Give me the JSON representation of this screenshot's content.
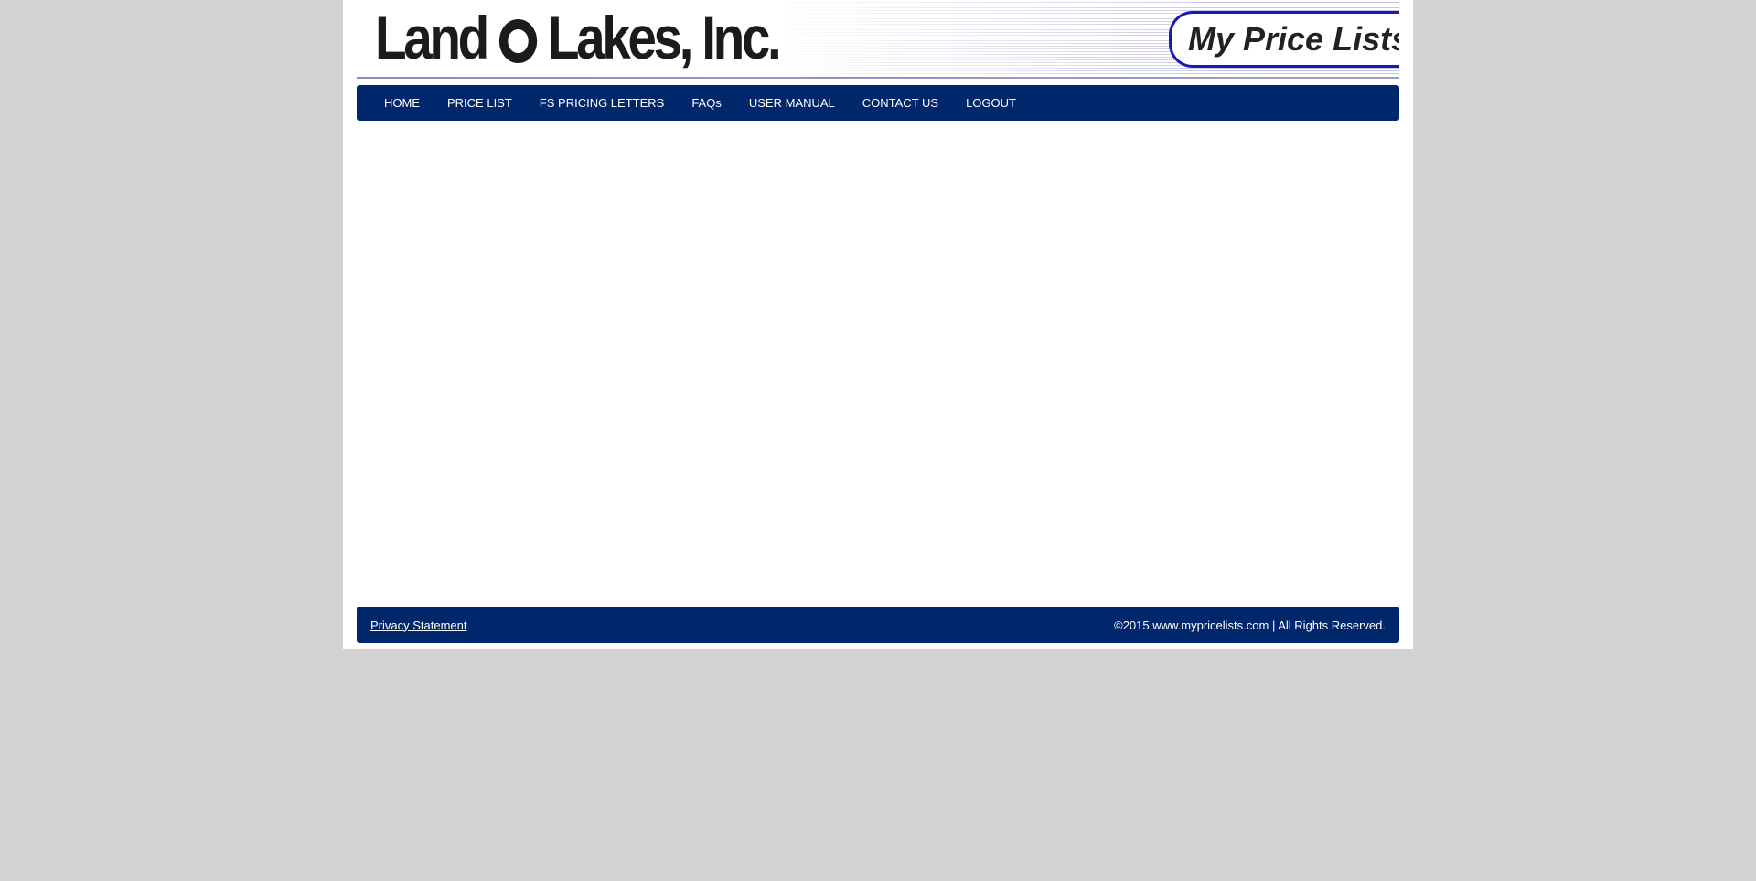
{
  "header": {
    "logo_part1": "Land",
    "logo_part2": "Lakes, Inc.",
    "badge": "My Price Lists"
  },
  "nav": {
    "items": [
      {
        "label": "HOME"
      },
      {
        "label": "PRICE LIST"
      },
      {
        "label": "FS PRICING LETTERS"
      },
      {
        "label": "FAQs"
      },
      {
        "label": "USER MANUAL"
      },
      {
        "label": "CONTACT US"
      },
      {
        "label": "LOGOUT"
      }
    ]
  },
  "footer": {
    "privacy": "Privacy Statement",
    "copyright": "©2015 www.mypricelists.com | All Rights Reserved."
  },
  "colors": {
    "nav_bg": "#00266b",
    "page_bg": "#d3d3d3",
    "badge_border": "#1a1ab0"
  }
}
